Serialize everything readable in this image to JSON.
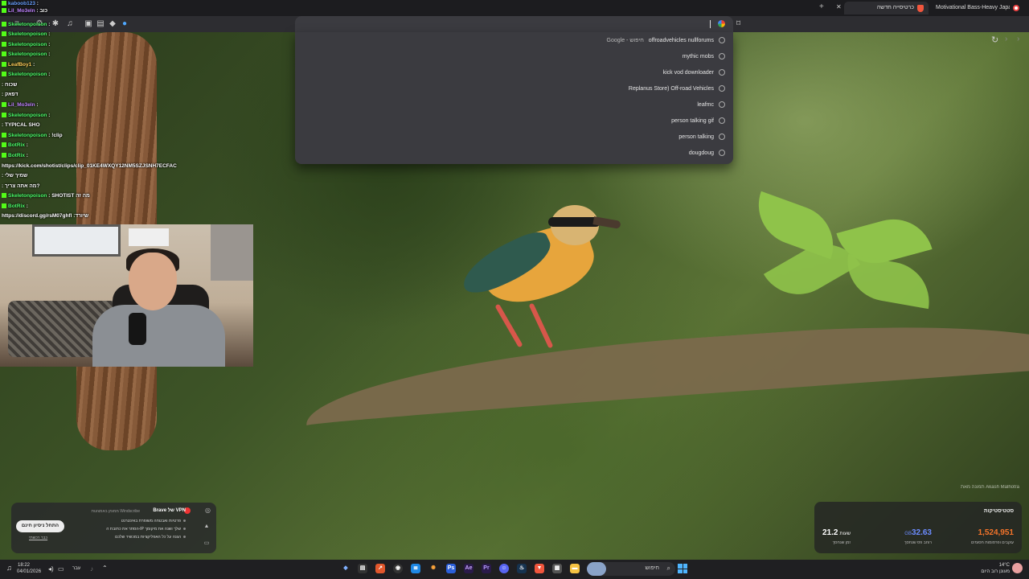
{
  "tabs": [
    {
      "title": "Motivational Bass-Heavy Japanes",
      "active": false
    },
    {
      "title": "כרטיסייה חדשה",
      "active": true
    }
  ],
  "omnibox": {
    "value": ""
  },
  "suggestions": [
    {
      "text": "offroadvehicles nullforums",
      "prefix": "Google - חיפוש"
    },
    {
      "text": "mythic mobs"
    },
    {
      "text": "kick vod downloader"
    },
    {
      "text": "Replanus Store) Off-road Vehicles"
    },
    {
      "text": "leafmc"
    },
    {
      "text": "person talking gif"
    },
    {
      "text": "person talking"
    },
    {
      "text": "dougdoug"
    }
  ],
  "chat": [
    {
      "user": "kaboob123",
      "msg": ":",
      "cls": "u-blue"
    },
    {
      "user": "Lil_Mo3eln",
      "msg": ": כוב",
      "cls": "u-purple"
    },
    {
      "user": "Skeletonpoison",
      "msg": ":",
      "cls": "u-skel"
    },
    {
      "user": "Skeletonpoison",
      "msg": ":",
      "cls": "u-skel"
    },
    {
      "user": "Skeletonpoison",
      "msg": ":",
      "cls": "u-skel"
    },
    {
      "user": "Skeletonpoison",
      "msg": ":",
      "cls": "u-skel"
    },
    {
      "user": "LeafBoy1",
      "msg": ":",
      "cls": "u-leaf"
    },
    {
      "user": "Skeletonpoison",
      "msg": ":",
      "cls": "u-skel"
    },
    {
      "user": "",
      "msg": ": שכוח",
      "cls": "u-blue"
    },
    {
      "user": "",
      "msg": ": דפאק",
      "cls": "u-blue"
    },
    {
      "user": "Lil_Mo3eln",
      "msg": ":",
      "cls": "u-purple"
    },
    {
      "user": "Skeletonpoison",
      "msg": ":",
      "cls": "u-skel"
    },
    {
      "user": "",
      "msg": ": TYPICAL SHO",
      "cls": "u-blue"
    },
    {
      "user": "Skeletonpoison",
      "msg": ": !clip",
      "cls": "u-skel"
    },
    {
      "user": "BotRix",
      "msg": ":",
      "cls": "u-bot"
    },
    {
      "user": "BotRix",
      "msg": ":",
      "cls": "u-bot"
    },
    {
      "user": "",
      "msg": "https://kick.com/shotist/clips/clip_01KE4WXQY12NM5SZJSNH7ECFAC",
      "cls": "msg"
    },
    {
      "user": "",
      "msg": ": שמיך שלי",
      "cls": "u-blue"
    },
    {
      "user": "",
      "msg": ": מה אתה צריך?",
      "cls": "u-blue"
    },
    {
      "user": "Skeletonpoison",
      "msg": ": SHOTIST מה זה",
      "cls": "u-skel"
    },
    {
      "user": "BotRix",
      "msg": ":",
      "cls": "u-bot"
    },
    {
      "user": "",
      "msg": "https://discord.gg/rsM07ghfl :שיורד",
      "cls": "msg"
    }
  ],
  "vpn": {
    "title": "Brave של VPN",
    "subtitle": "ממומן באמצעות Windscribe",
    "features": [
      "פרטיות ואבטחה משופרת באינטרנט",
      "הסתר את כתובת ה-IP שלך ושנה את מיקומך",
      "הגנה על כל האפליקציות במכשיר שלכם"
    ],
    "try_label": "התחל ניסיון חינם",
    "link_label": "כבר רכשתי"
  },
  "stats": {
    "title": "סטטיסטיקות",
    "items": [
      {
        "value": "1,524,951",
        "unit": "",
        "label": "עוקבים ופרסומות חסומים",
        "color": "#f4742a"
      },
      {
        "value": "32.63",
        "unit": "GB",
        "label": "רוחב פס שנחסך",
        "color": "#6c8cff"
      },
      {
        "value": "21.2",
        "unit": "שעות",
        "label": "זמן שנחסך",
        "color": "#ffffff"
      }
    ]
  },
  "taskbar": {
    "time": "18:22",
    "date": "04/01/2026",
    "lang": "עבר",
    "search_label": "חיפוש",
    "weather_temp": "14°C",
    "weather_desc": "מעונן רוב היום"
  },
  "wallpaper_credit": "תמונה מאת Akash Malhotra",
  "colors": {
    "accent": "#f1563d",
    "chat_green": "#53fc18"
  }
}
